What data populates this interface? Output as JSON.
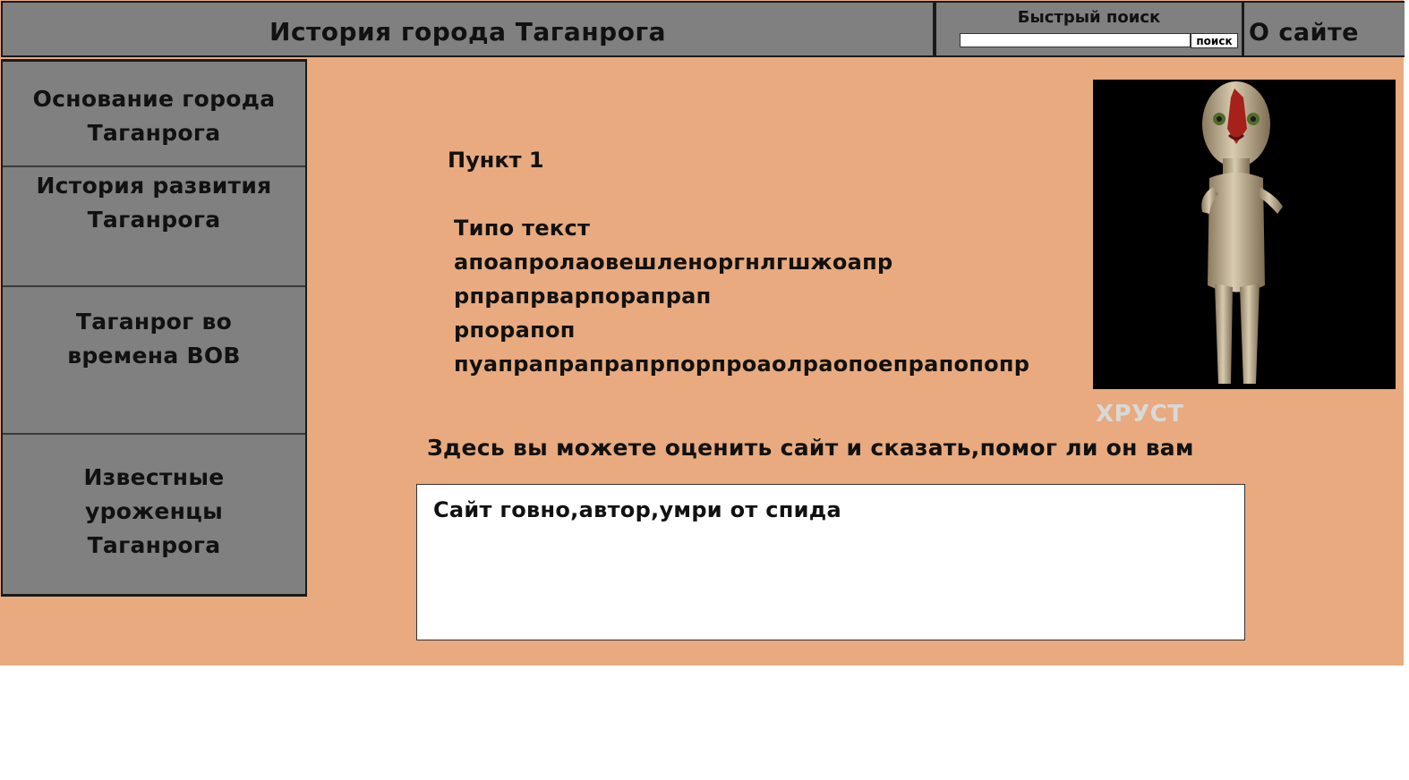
{
  "header": {
    "title": "История города Таганрога",
    "search_label": "Быстрый поиск",
    "search_value": "",
    "search_button": "поиск",
    "about_link": "О сайте"
  },
  "sidebar": {
    "items": [
      {
        "lines": [
          "Основание города",
          "Таганрога"
        ]
      },
      {
        "lines": [
          "История развития",
          "Таганрога"
        ]
      },
      {
        "lines": [
          "Таганрог во",
          "времена ВОВ"
        ]
      },
      {
        "lines": [
          "Известные",
          "уроженцы",
          "Таганрога"
        ]
      }
    ]
  },
  "main": {
    "section_title": "Пункт 1",
    "body_lines": [
      "Типо текст",
      "апоапролаовешленоргнлгшжоапр",
      "рпрапрварпорапрап",
      "рпорапоп",
      "пуапрапрапрапрпорпроаолраопоепрапопопр"
    ],
    "image_caption": "ХРУСТ",
    "image_icon": "figure-image",
    "rate_prompt": "Здесь вы можете оценить сайт и сказать,помог ли он вам",
    "feedback_value": "Сайт говно,автор,умри от спида"
  },
  "colors": {
    "header_bg": "#808080",
    "sidebar_bg": "#808080",
    "content_bg": "#e8aa7e",
    "caption": "#d9d9d9"
  }
}
